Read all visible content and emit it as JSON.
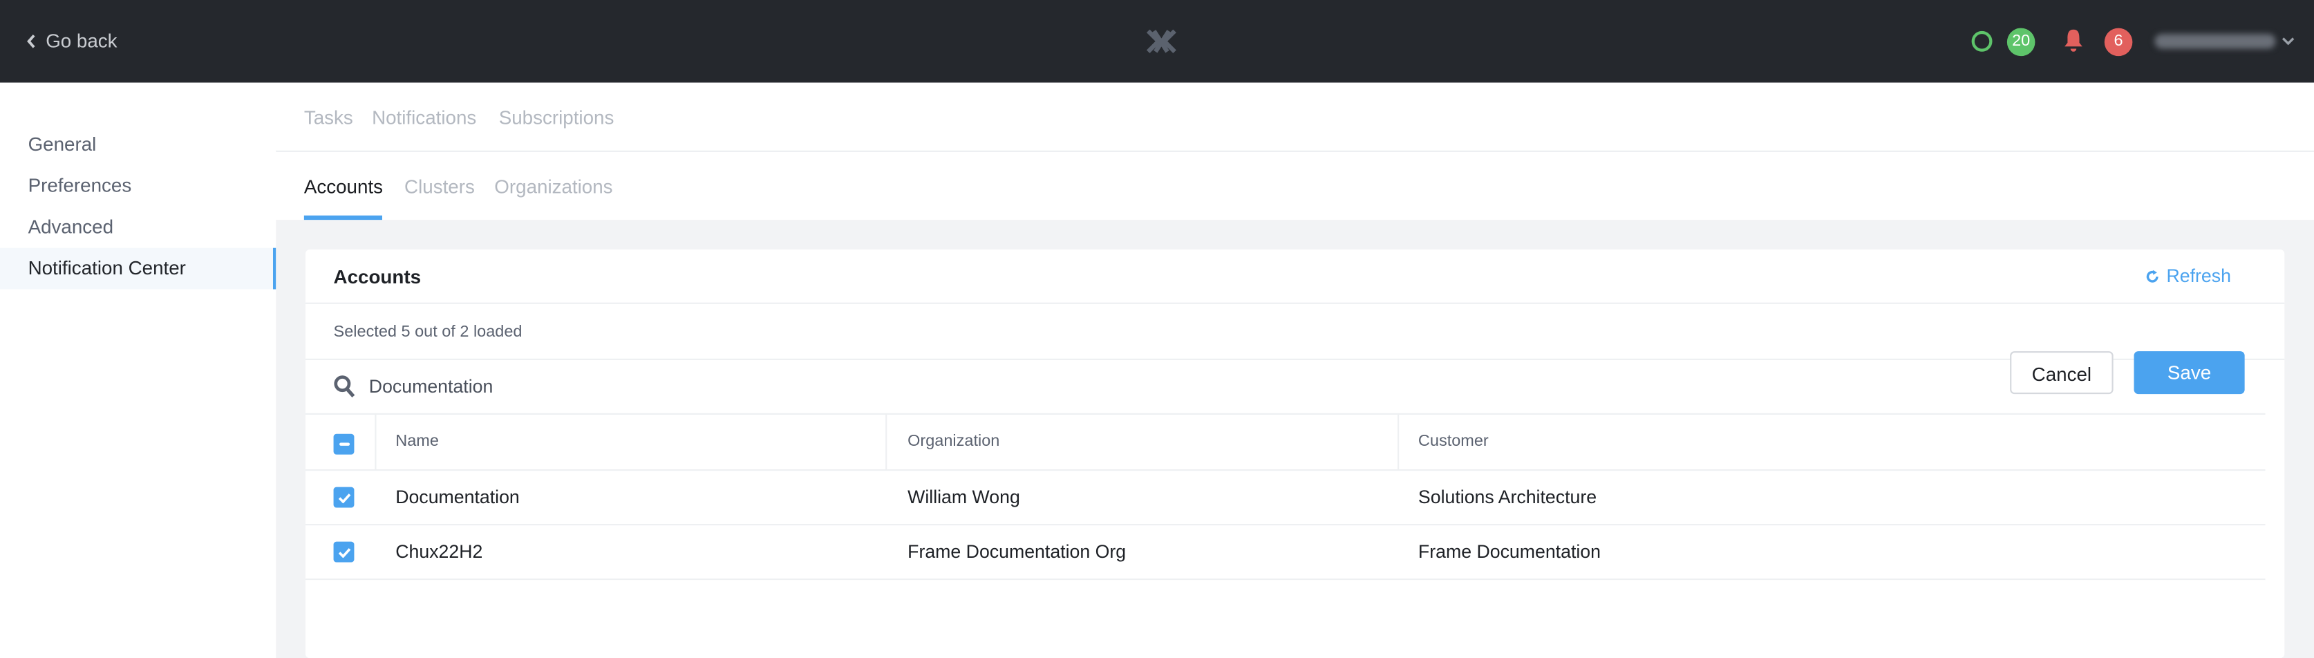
{
  "topbar": {
    "go_back": "Go back",
    "task_count": "20",
    "notification_count": "6",
    "status_color": "#5ec46a",
    "alert_color": "#e2605d"
  },
  "sidebar": {
    "items": [
      {
        "label": "General"
      },
      {
        "label": "Preferences"
      },
      {
        "label": "Advanced"
      },
      {
        "label": "Notification Center",
        "active": true
      }
    ]
  },
  "tabs_primary": [
    {
      "label": "Tasks"
    },
    {
      "label": "Notifications"
    },
    {
      "label": "Subscriptions"
    }
  ],
  "tabs_secondary": [
    {
      "label": "Accounts",
      "active": true
    },
    {
      "label": "Clusters"
    },
    {
      "label": "Organizations"
    }
  ],
  "card": {
    "title": "Accounts",
    "refresh": "Refresh",
    "selection_status": "Selected 5 out of 2 loaded",
    "search_value": "Documentation",
    "cancel": "Cancel",
    "save": "Save",
    "columns": [
      "Name",
      "Organization",
      "Customer"
    ],
    "rows": [
      {
        "name": "Documentation",
        "organization": "William Wong",
        "customer": "Solutions Architecture",
        "checked": true
      },
      {
        "name": "Chux22H2",
        "organization": "Frame Documentation Org",
        "customer": "Frame Documentation",
        "checked": true
      }
    ]
  },
  "accent_color": "#4ba3ef"
}
